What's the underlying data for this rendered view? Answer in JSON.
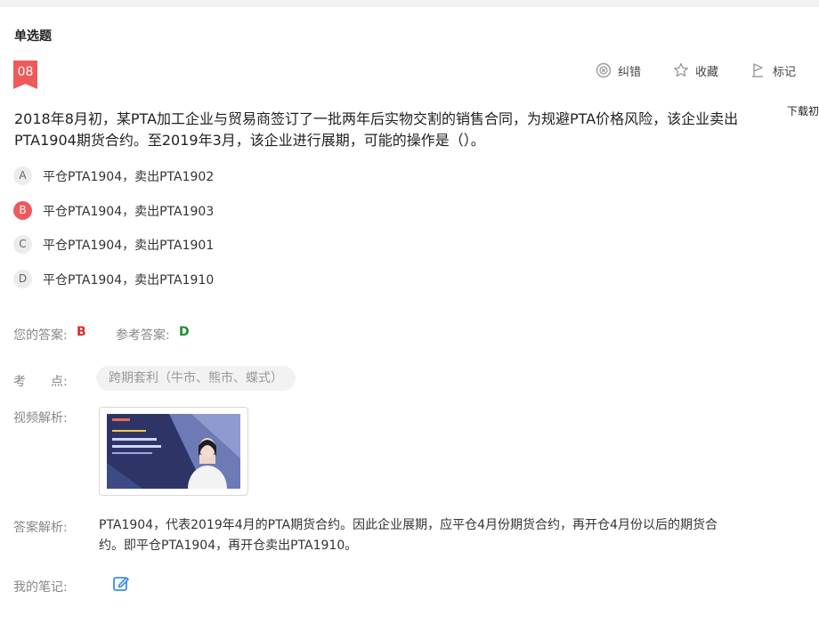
{
  "question": {
    "type_label": "单选题",
    "number": "08",
    "stem": "2018年8月初，某PTA加工企业与贸易商签订了一批两年后实物交割的销售合同，为规避PTA价格风险，该企业卖出PTA1904期货合约。至2019年3月，该企业进行展期，可能的操作是（）。",
    "options": [
      {
        "letter": "A",
        "text": "平仓PTA1904，卖出PTA1902"
      },
      {
        "letter": "B",
        "text": "平仓PTA1904，卖出PTA1903"
      },
      {
        "letter": "C",
        "text": "平仓PTA1904，卖出PTA1901"
      },
      {
        "letter": "D",
        "text": "平仓PTA1904，卖出PTA1910"
      }
    ],
    "selected": "B"
  },
  "actions": {
    "correct_label": "纠错",
    "favorite_label": "收藏",
    "mark_label": "标记"
  },
  "side": {
    "download_label": "下载初"
  },
  "answer": {
    "your_label": "您的答案:",
    "your_value": "B",
    "ref_label": "参考答案:",
    "ref_value": "D"
  },
  "point": {
    "label": "考　　点:",
    "tag": "跨期套利（牛市、熊市、蝶式）"
  },
  "video": {
    "label": "视频解析:"
  },
  "explanation": {
    "label": "答案解析:",
    "text": "PTA1904，代表2019年4月的PTA期货合约。因此企业展期，应平仓4月份期货合约，再开仓4月份以后的期货合约。即平仓PTA1904，再开仓卖出PTA1910。"
  },
  "notes": {
    "label": "我的笔记:"
  },
  "colors": {
    "accent": "#f0595a",
    "wrong": "#e02a2a",
    "correct": "#1c8f2f",
    "link": "#3a8ee6"
  }
}
